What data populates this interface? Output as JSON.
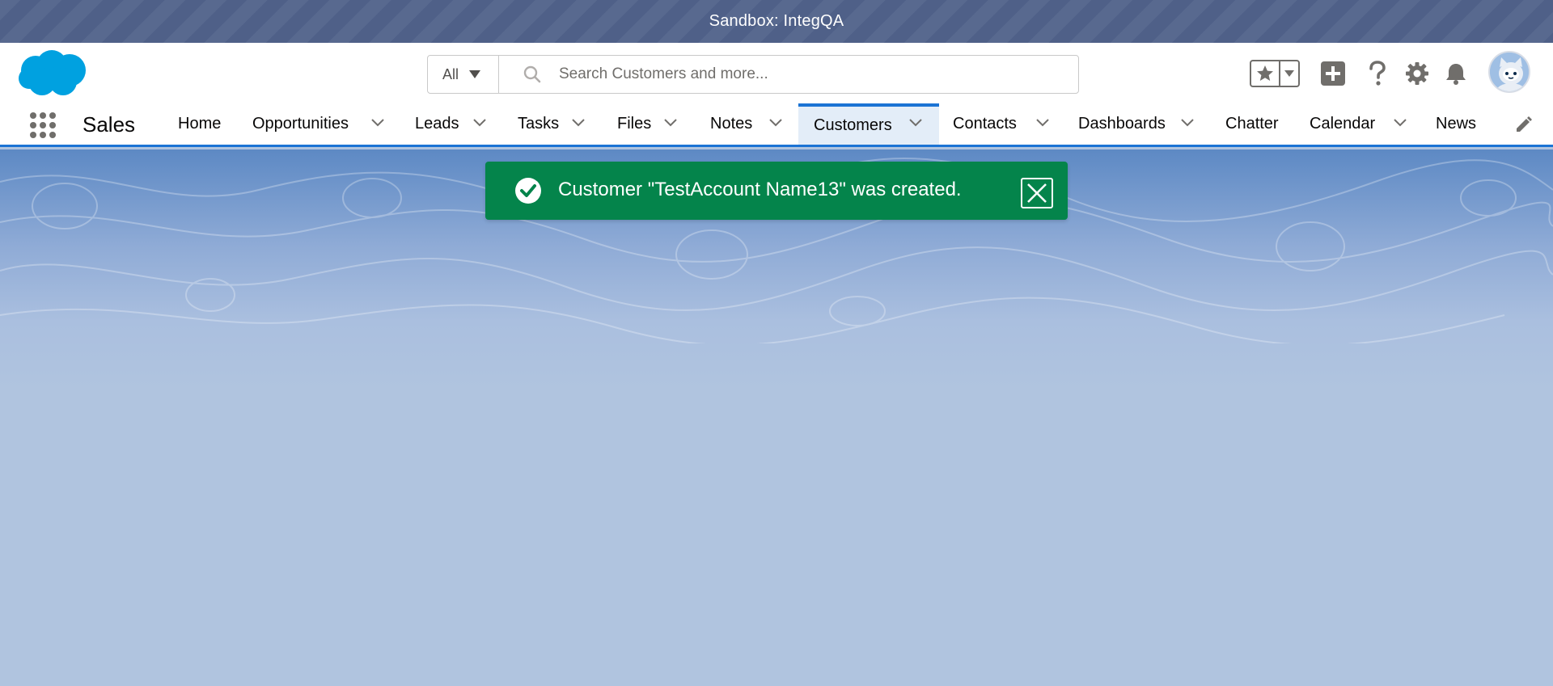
{
  "sandbox": {
    "label": "Sandbox: IntegQA"
  },
  "search": {
    "scope_label": "All",
    "placeholder": "Search Customers and more..."
  },
  "header_icons": [
    "favorites-star-icon",
    "favorites-dropdown-icon",
    "global-create-icon",
    "help-icon",
    "setup-gear-icon",
    "notifications-bell-icon",
    "user-avatar"
  ],
  "app": {
    "name": "Sales"
  },
  "nav": {
    "items": [
      {
        "label": "Home",
        "has_menu": false
      },
      {
        "label": "Opportunities",
        "has_menu": true
      },
      {
        "label": "Leads",
        "has_menu": true
      },
      {
        "label": "Tasks",
        "has_menu": true
      },
      {
        "label": "Files",
        "has_menu": true
      },
      {
        "label": "Notes",
        "has_menu": true
      },
      {
        "label": "Customers",
        "has_menu": true,
        "active": true
      },
      {
        "label": "Contacts",
        "has_menu": true
      },
      {
        "label": "Dashboards",
        "has_menu": true
      },
      {
        "label": "Chatter",
        "has_menu": false
      },
      {
        "label": "Calendar",
        "has_menu": true
      },
      {
        "label": "News",
        "has_menu": false
      }
    ]
  },
  "toast": {
    "message": "Customer \"TestAccount Name13\" was created.",
    "type": "success"
  },
  "colors": {
    "brand": "#1b73d4",
    "success": "#04844b",
    "sandbox_bar": "#58698f",
    "page_background": "#b0c4df"
  }
}
